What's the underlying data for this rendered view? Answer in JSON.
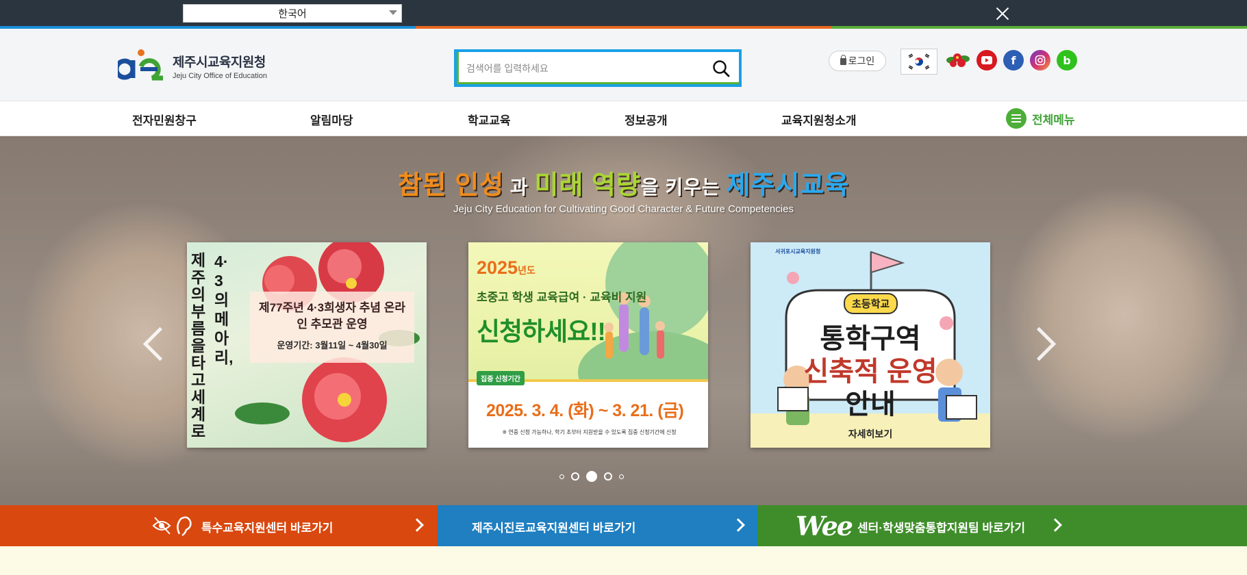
{
  "topbar": {
    "language_value": "한국어",
    "colors": [
      "#1a8fd8",
      "#e9681f",
      "#5aad3a"
    ]
  },
  "header": {
    "logo_title": "제주시교육지원청",
    "logo_subtitle": "Jeju City Office of Education",
    "search_placeholder": "검색어를 입력하세요",
    "login_label": "로그인",
    "social_icons": [
      "korea-flag-icon",
      "camellia-icon",
      "youtube-icon",
      "facebook-icon",
      "instagram-icon",
      "blog-icon"
    ]
  },
  "nav": {
    "items": [
      "전자민원창구",
      "알림마당",
      "학교교육",
      "정보공개",
      "교육지원청소개"
    ],
    "all_menu_label": "전체메뉴"
  },
  "hero": {
    "title_parts": [
      "참된 인성",
      " 과 ",
      "미래 역량",
      "을 키우는 ",
      "제주시교육"
    ],
    "subtitle": "Jeju City Education for Cultivating Good Character & Future Competencies",
    "slides": [
      {
        "vertical_text_1": "4·3의 메아리,",
        "vertical_text_2": "제주의 부름을 타고 세계로",
        "headline": "제77주년 4·3희생자 추념 온라인 추모관 운영",
        "period": "운영기간: 3월11일 ~ 4월30일"
      },
      {
        "year": "2025",
        "year_suffix": "년도",
        "line1": "초중고 학생 교육급여 · 교육비 지원",
        "line2": "신청하세요!!",
        "badge": "집중 신청기간",
        "dates": "2025. 3. 4. (화) ~ 3. 21. (금)",
        "note": "※ 연중 신청 가능하나, 학기 초부터 지원받을 수 있도록 집중 신청기간에 신청"
      },
      {
        "org": "서귀포시교육지원청",
        "badge": "초등학교",
        "line1": "통학구역",
        "line2": "신축적 운영",
        "line3": "안내",
        "link": "자세히보기"
      }
    ],
    "pagination_count": 5,
    "active_index": 2
  },
  "bottom_links": [
    {
      "label": "특수교육지원센터 바로가기",
      "color": "#d9480f"
    },
    {
      "label": "제주시진로교육지원센터 바로가기",
      "color": "#1f7fc1"
    },
    {
      "label": "센터·학생맞춤통합지원팀 바로가기",
      "color": "#3f8d2a",
      "logo": "Wee"
    }
  ]
}
